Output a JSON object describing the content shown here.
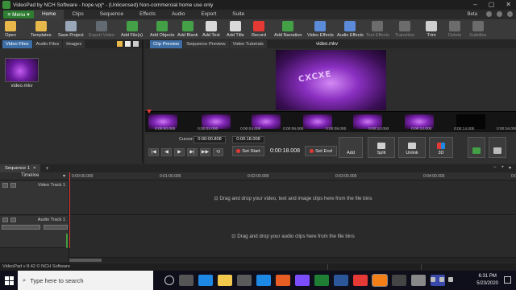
{
  "window": {
    "title": "VideoPad by NCH Software - hope.vpj* - (Unlicensed) Non-commercial home use only",
    "controls": [
      "–",
      "▢",
      "✕"
    ]
  },
  "tabs": {
    "menu_label": "Menu",
    "items": [
      "Home",
      "Clips",
      "Sequence",
      "Effects",
      "Audio",
      "Export",
      "Suite"
    ],
    "beta": "Beta"
  },
  "toolbar": [
    {
      "label": "Open",
      "icon": "open-folder-icon",
      "color": "#e8b84a",
      "enabled": true
    },
    {
      "label": "Templates",
      "icon": "templates-icon",
      "color": "#e8b84a",
      "enabled": true
    },
    {
      "label": "Save Project",
      "icon": "save-icon",
      "color": "#9aa7b8",
      "enabled": true
    },
    {
      "label": "Export Video",
      "icon": "export-video-icon",
      "color": "#9aa7b8",
      "enabled": false
    },
    {
      "label": "Add File(s)",
      "icon": "add-files-icon",
      "color": "#43a047",
      "enabled": true
    },
    {
      "label": "Add Objects",
      "icon": "add-objects-icon",
      "color": "#43a047",
      "enabled": true
    },
    {
      "label": "Add Blank",
      "icon": "add-blank-icon",
      "color": "#43a047",
      "enabled": true
    },
    {
      "label": "Add Text",
      "icon": "add-text-icon",
      "color": "#d9d9d9",
      "enabled": true
    },
    {
      "label": "Add Title",
      "icon": "add-title-icon",
      "color": "#d9d9d9",
      "enabled": true
    },
    {
      "label": "Record",
      "icon": "record-icon",
      "color": "#e53935",
      "enabled": true
    },
    {
      "label": "Add Narration",
      "icon": "add-narration-icon",
      "color": "#43a047",
      "enabled": true
    },
    {
      "label": "Video Effects",
      "icon": "video-effects-icon",
      "color": "#5b8bd9",
      "enabled": true
    },
    {
      "label": "Audio Effects",
      "icon": "audio-effects-icon",
      "color": "#5b8bd9",
      "enabled": true
    },
    {
      "label": "Text Effects",
      "icon": "text-effects-icon",
      "color": "#aaaaaa",
      "enabled": false
    },
    {
      "label": "Transition",
      "icon": "transition-icon",
      "color": "#aaaaaa",
      "enabled": false
    },
    {
      "label": "Trim",
      "icon": "trim-icon",
      "color": "#cfcfcf",
      "enabled": true
    },
    {
      "label": "Delete",
      "icon": "delete-icon",
      "color": "#aaaaaa",
      "enabled": false
    },
    {
      "label": "Subtitles",
      "icon": "subtitles-icon",
      "color": "#aaaaaa",
      "enabled": false
    }
  ],
  "bins": {
    "tabs": [
      "Video Files",
      "Audio Files",
      "Images"
    ],
    "clip_name": "video.mkv"
  },
  "preview": {
    "tabs": [
      "Clip Preview",
      "Sequence Preview",
      "Video Tutorials"
    ],
    "file_name": "video.mkv",
    "video_overlay_text": "CXCXE",
    "film_times": [
      "0:00:00.000",
      "0:00:02.000",
      "0:00:04.000",
      "0:00:06.000",
      "0:00:08.000",
      "0:00:10.000",
      "0:00:12.000",
      "0:00:14.000",
      "0:00:16.000"
    ],
    "cursor_label": "Cursor:",
    "cursor_time": "0:00:00.808",
    "end_time": "0:00:18.008",
    "current_time": "0:00:18.008",
    "set_start": "Set Start",
    "set_end": "Set End",
    "add": "Add",
    "split": "Split",
    "unlink": "Unlink",
    "three_d": "3D"
  },
  "sequence": {
    "tab_label": "Sequence 1",
    "timeline_label": "Timeline",
    "ruler": [
      "0:00:00.000",
      "0:01:00.000",
      "0:02:00.000",
      "0:03:00.000",
      "0:04:00.000",
      "0:05:00.000"
    ],
    "video_track": "Video Track 1",
    "audio_track": "Audio Track 1",
    "video_drop": "Drag and drop your video, text and image clips here from the file bins",
    "audio_drop": "Drag and drop your audio clips here from the file bins"
  },
  "status": "VideoPad v 8.42 © NCH Software",
  "taskbar": {
    "search_placeholder": "Type here to search",
    "time": "6:31 PM",
    "date": "5/23/2020"
  }
}
